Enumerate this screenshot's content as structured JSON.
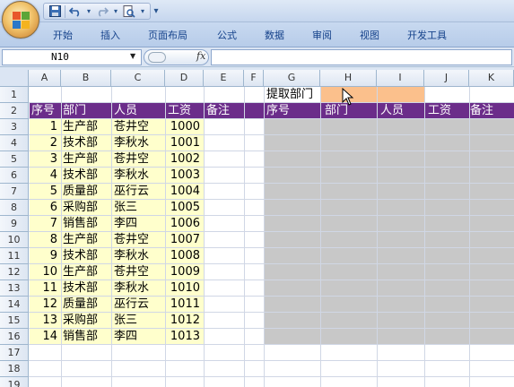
{
  "window": {
    "quick_access": [
      "save-icon",
      "undo-icon",
      "redo-icon",
      "print-preview-icon"
    ]
  },
  "ribbon": {
    "tabs": [
      "开始",
      "插入",
      "页面布局",
      "公式",
      "数据",
      "审阅",
      "视图",
      "开发工具"
    ]
  },
  "formula_bar": {
    "name_box": "N10",
    "fx": "fx",
    "formula": ""
  },
  "columns": [
    "A",
    "B",
    "C",
    "D",
    "E",
    "F",
    "G",
    "H",
    "I",
    "J",
    "K"
  ],
  "rows": [
    "1",
    "2",
    "3",
    "4",
    "5",
    "6",
    "7",
    "8",
    "9",
    "10",
    "11",
    "12",
    "13",
    "14",
    "15",
    "16",
    "17",
    "18",
    "19"
  ],
  "sheet": {
    "extract_label": "提取部门",
    "extract_value": "",
    "left_headers": [
      "序号",
      "部门",
      "人员",
      "工资",
      "备注"
    ],
    "right_headers": [
      "序号",
      "部门",
      "人员",
      "工资",
      "备注"
    ],
    "records": [
      {
        "no": "1",
        "dept": "生产部",
        "name": "苍井空",
        "salary": "1000"
      },
      {
        "no": "2",
        "dept": "技术部",
        "name": "李秋水",
        "salary": "1001"
      },
      {
        "no": "3",
        "dept": "生产部",
        "name": "苍井空",
        "salary": "1002"
      },
      {
        "no": "4",
        "dept": "技术部",
        "name": "李秋水",
        "salary": "1003"
      },
      {
        "no": "5",
        "dept": "质量部",
        "name": "巫行云",
        "salary": "1004"
      },
      {
        "no": "6",
        "dept": "采购部",
        "name": "张三",
        "salary": "1005"
      },
      {
        "no": "7",
        "dept": "销售部",
        "name": "李四",
        "salary": "1006"
      },
      {
        "no": "8",
        "dept": "生产部",
        "name": "苍井空",
        "salary": "1007"
      },
      {
        "no": "9",
        "dept": "技术部",
        "name": "李秋水",
        "salary": "1008"
      },
      {
        "no": "10",
        "dept": "生产部",
        "name": "苍井空",
        "salary": "1009"
      },
      {
        "no": "11",
        "dept": "技术部",
        "name": "李秋水",
        "salary": "1010"
      },
      {
        "no": "12",
        "dept": "质量部",
        "name": "巫行云",
        "salary": "1011"
      },
      {
        "no": "13",
        "dept": "采购部",
        "name": "张三",
        "salary": "1012"
      },
      {
        "no": "14",
        "dept": "销售部",
        "name": "李四",
        "salary": "1013"
      }
    ]
  },
  "colors": {
    "header_band": "#6b2d8a",
    "data_fill": "#ffffcc",
    "result_fill": "#c8c8c8",
    "input_fill": "#fbc08c"
  }
}
